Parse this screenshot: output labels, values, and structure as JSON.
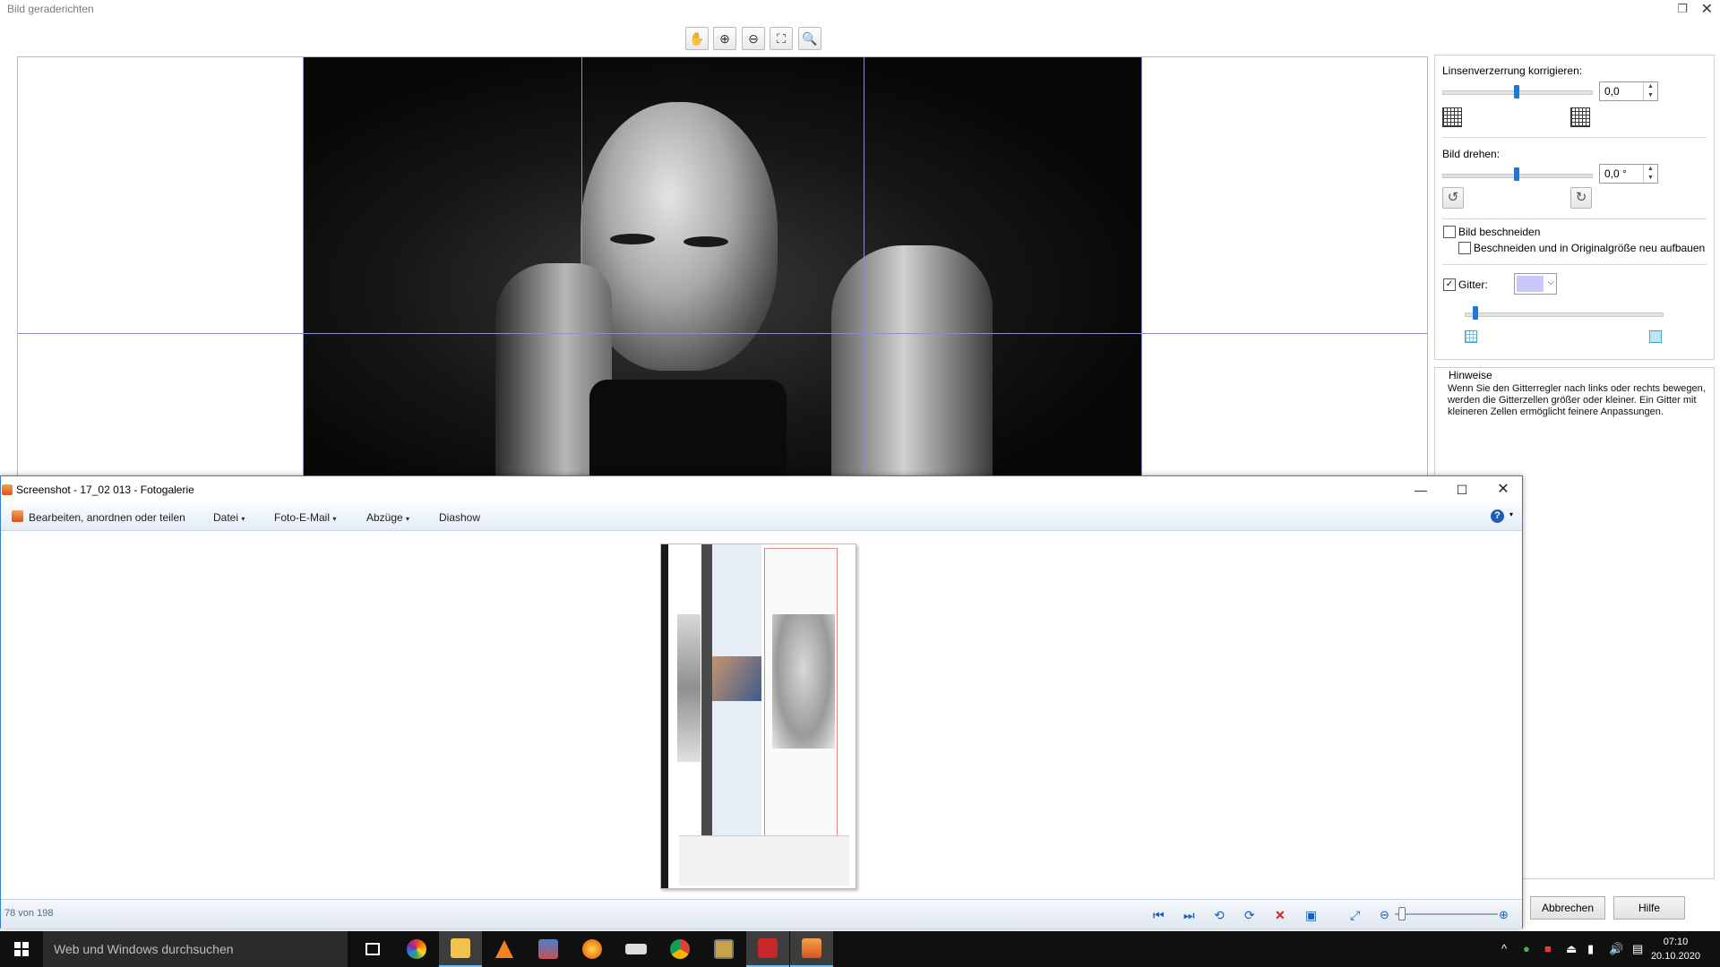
{
  "dialog": {
    "title": "Bild geraderichten",
    "lens_label": "Linsenverzerrung korrigieren:",
    "lens_value": 0.0,
    "lens_value_text": "0,0",
    "rotate_label": "Bild drehen:",
    "rotate_value": 0.0,
    "rotate_value_text": "0,0 °",
    "crop_label": "Bild beschneiden",
    "crop_checked": false,
    "crop_rebuild_label": "Beschneiden und in Originalgröße neu aufbauen",
    "crop_rebuild_checked": false,
    "grid_label": "Gitter:",
    "grid_checked": true,
    "grid_color": "#c8c8ff",
    "hints_title": "Hinweise",
    "hints_text": "Wenn Sie den Gitterregler nach links oder rechts bewegen, werden die Gitterzellen größer oder kleiner. Ein Gitter mit kleineren Zellen ermöglicht feinere Anpassungen.",
    "cancel_label": "Abbrechen",
    "help_label": "Hilfe",
    "toolbar_icons": [
      "hand-icon",
      "zoom-in-icon",
      "zoom-out-icon",
      "fit-icon",
      "actual-size-icon"
    ]
  },
  "gallery": {
    "title": "Screenshot - 17_02 013 - Fotogalerie",
    "menu": {
      "edit": "Bearbeiten, anordnen oder teilen",
      "file": "Datei",
      "email": "Foto-E-Mail",
      "prints": "Abzüge",
      "slideshow": "Diashow"
    },
    "status": "78 von 198",
    "window_controls": [
      "minimize-icon",
      "maximize-icon",
      "close-icon"
    ]
  },
  "taskbar": {
    "search_placeholder": "Web und Windows durchsuchen",
    "time": "07:10",
    "date": "20.10.2020"
  },
  "colors": {
    "accent": "#1b78d4",
    "grid_line": "#8c8fc7",
    "taskbar": "#101010"
  }
}
